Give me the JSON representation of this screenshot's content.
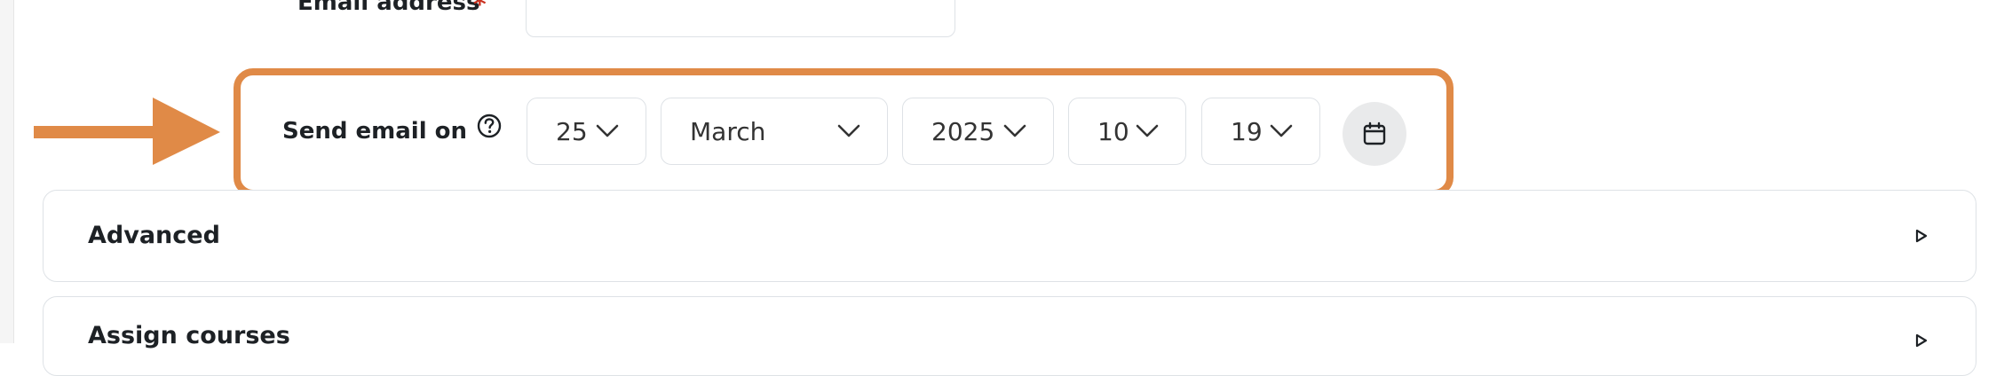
{
  "email_field": {
    "label": "Email address",
    "required_marker": "*",
    "value": ""
  },
  "send_email": {
    "label": "Send email on",
    "help_icon": "question-circle-icon",
    "day": "25",
    "month": "March",
    "year": "2025",
    "hour": "10",
    "minute": "19",
    "calendar_icon": "calendar-icon"
  },
  "annotation": {
    "arrow_color": "#e08a47",
    "highlight_color": "#e08a47"
  },
  "sections": {
    "advanced": {
      "title": "Advanced",
      "toggle_icon": "caret-right-icon"
    },
    "assign_courses": {
      "title": "Assign courses",
      "toggle_icon": "caret-right-icon"
    }
  }
}
